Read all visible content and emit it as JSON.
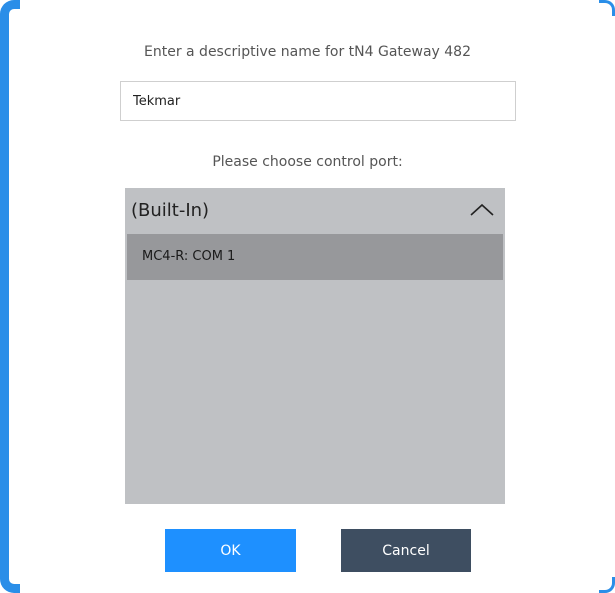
{
  "dialog": {
    "prompt": "Enter a descriptive name for tN4 Gateway 482",
    "name_input": {
      "value": "Tekmar"
    },
    "port_label": "Please choose control port:",
    "port_list": {
      "group": {
        "title": "(Built-In)",
        "expanded_icon": "chevron-up-icon",
        "items": [
          {
            "label": "MC4-R: COM 1",
            "selected": true
          }
        ]
      }
    },
    "buttons": {
      "ok_label": "OK",
      "cancel_label": "Cancel"
    }
  },
  "colors": {
    "accent_border": "#2a8ee8",
    "ok_button": "#1e90ff",
    "cancel_button": "#3e4e61",
    "list_background": "#bfc1c4",
    "selected_item": "#97989b"
  }
}
